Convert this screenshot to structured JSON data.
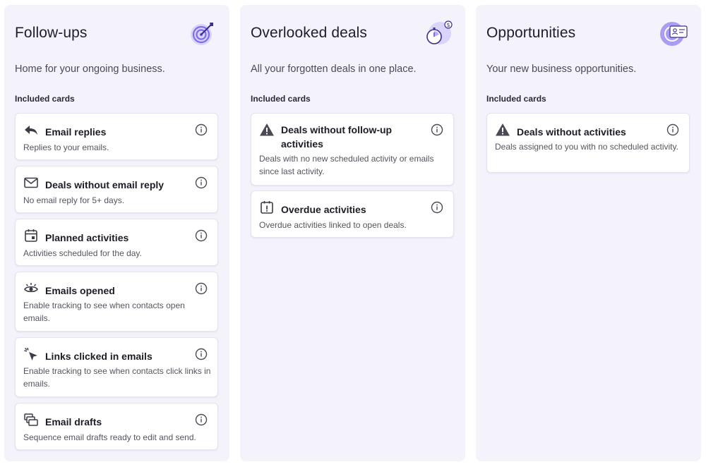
{
  "columns": [
    {
      "title": "Follow-ups",
      "illustration": "target-icon",
      "description": "Home for your ongoing business.",
      "section_label": "Included cards",
      "cards": [
        {
          "title": "Email replies",
          "description": "Replies to your emails.",
          "icon": "reply-icon"
        },
        {
          "title": "Deals without email reply",
          "description": "No email reply for 5+ days.",
          "icon": "envelope-icon"
        },
        {
          "title": "Planned activities",
          "description": "Activities scheduled for the day.",
          "icon": "calendar-icon"
        },
        {
          "title": "Emails opened",
          "description": "Enable tracking to see when contacts open emails.",
          "icon": "eye-icon"
        },
        {
          "title": "Links clicked in emails",
          "description": "Enable tracking to see when contacts click links in emails.",
          "icon": "cursor-click-icon"
        },
        {
          "title": "Email drafts",
          "description": "Sequence email drafts ready to edit and send.",
          "icon": "drafts-icon"
        }
      ]
    },
    {
      "title": "Overlooked deals",
      "illustration": "stopwatch-icon",
      "description": "All your forgotten deals in one place.",
      "section_label": "Included cards",
      "cards": [
        {
          "title": "Deals without follow-up activities",
          "description": "Deals with no new scheduled activity or emails since last activity.",
          "icon": "warning-icon"
        },
        {
          "title": "Overdue activities",
          "description": "Overdue activities linked to open deals.",
          "icon": "calendar-alert-icon"
        }
      ]
    },
    {
      "title": "Opportunities",
      "illustration": "contact-card-icon",
      "description": "Your new business opportunities.",
      "section_label": "Included cards",
      "cards": [
        {
          "title": "Deals without activities",
          "description": "Deals assigned to you with no scheduled activity.",
          "icon": "warning-icon"
        }
      ]
    }
  ],
  "colors": {
    "column_background": "#f4f3fc",
    "accent": "#7b6cf0",
    "accent_light": "#d9d4fb"
  }
}
